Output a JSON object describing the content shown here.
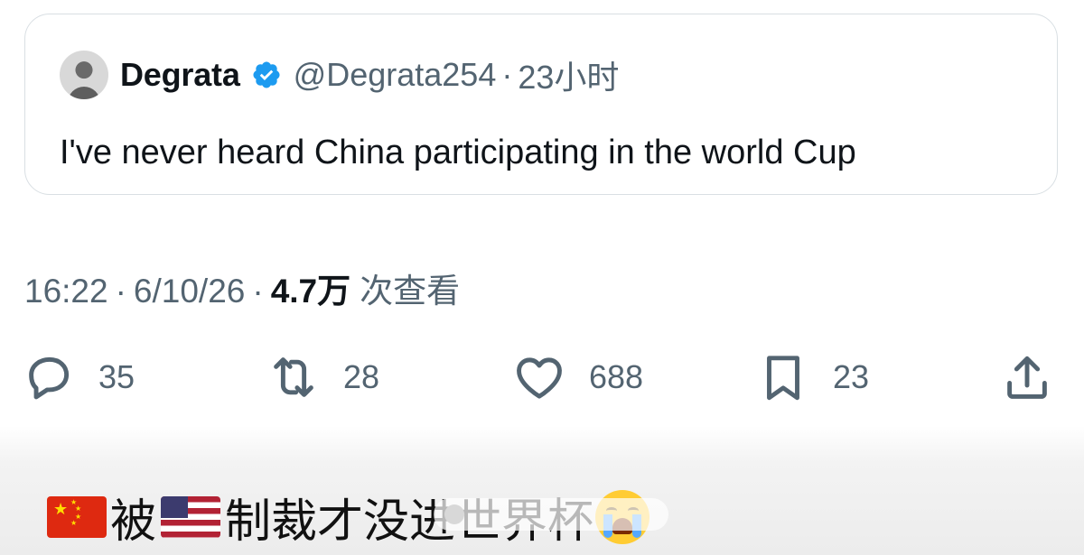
{
  "quoted_tweet": {
    "author_name": "Degrata",
    "handle": "@Degrata254",
    "separator": "·",
    "time": "23小时",
    "text": "I've never heard China participating in the world Cup"
  },
  "tweet_meta": {
    "time": "16:22",
    "separator": "·",
    "date": "6/10/26",
    "views_count": "4.7万",
    "views_label": "次查看"
  },
  "actions": {
    "replies": "35",
    "retweets": "28",
    "likes": "688",
    "bookmarks": "23"
  },
  "caption": {
    "before_flag": "被",
    "after_flag": "制裁才没进世界杯"
  },
  "icons": {
    "verified": "verified-badge-icon",
    "reply": "reply-icon",
    "retweet": "retweet-icon",
    "like": "heart-icon",
    "bookmark": "bookmark-icon",
    "share": "share-icon",
    "china_flag": "china-flag-icon",
    "us_flag": "us-flag-icon",
    "crying_emoji": "crying-face-icon"
  },
  "colors": {
    "text_primary": "#0f1419",
    "text_secondary": "#536471",
    "verified_blue": "#1d9bf0",
    "border": "#d9dfe3"
  }
}
